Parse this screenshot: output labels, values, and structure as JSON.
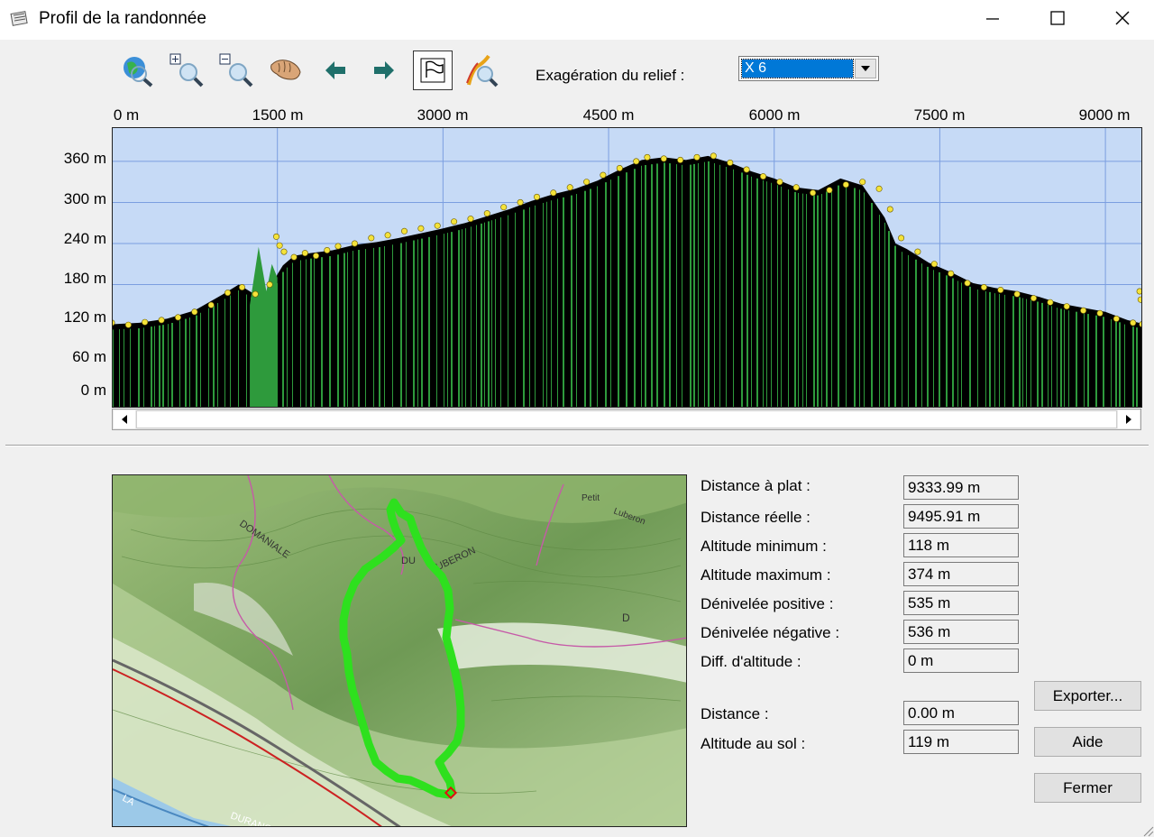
{
  "window": {
    "title": "Profil de la randonnée",
    "icon": "notepad-app-icon",
    "controls": [
      "minimize-icon",
      "maximize-icon",
      "close-icon"
    ]
  },
  "toolbar": {
    "tools": [
      {
        "name": "globe-zoom-icon"
      },
      {
        "name": "zoom-in-icon"
      },
      {
        "name": "zoom-out-icon"
      },
      {
        "name": "pan-hand-icon"
      },
      {
        "name": "arrow-left-icon"
      },
      {
        "name": "arrow-right-icon"
      },
      {
        "name": "flag-icon",
        "pressed": true
      },
      {
        "name": "path-zoom-icon"
      }
    ],
    "relief_label": "Exagération du relief :",
    "relief_value": "X 6"
  },
  "chart_data": {
    "type": "area",
    "x_ticks": [
      "0 m",
      "1500 m",
      "3000 m",
      "4500 m",
      "6000 m",
      "7500 m",
      "9000 m"
    ],
    "y_ticks": [
      "360 m",
      "300 m",
      "240 m",
      "180 m",
      "120 m",
      "60 m",
      "0 m"
    ],
    "xlim": [
      0,
      9333.99
    ],
    "ylim": [
      0,
      410
    ],
    "grid": true,
    "x": [
      0,
      250,
      500,
      750,
      1000,
      1150,
      1300,
      1400,
      1500,
      1550,
      1650,
      1800,
      2000,
      2200,
      2400,
      2600,
      2800,
      3000,
      3200,
      3400,
      3600,
      3800,
      4000,
      4200,
      4400,
      4600,
      4800,
      5000,
      5200,
      5400,
      5600,
      5800,
      6000,
      6200,
      6400,
      6600,
      6800,
      7000,
      7100,
      7200,
      7400,
      7600,
      7800,
      8000,
      8200,
      8400,
      8600,
      8800,
      9000,
      9200,
      9333
    ],
    "y": [
      122,
      124,
      130,
      142,
      165,
      180,
      165,
      158,
      195,
      208,
      222,
      226,
      230,
      238,
      242,
      248,
      255,
      262,
      270,
      280,
      290,
      302,
      312,
      320,
      332,
      348,
      362,
      366,
      362,
      368,
      358,
      345,
      335,
      322,
      318,
      335,
      325,
      278,
      240,
      232,
      212,
      198,
      182,
      175,
      170,
      162,
      152,
      146,
      140,
      128,
      123
    ],
    "series": [
      {
        "values_ref": "y",
        "color": "#000000"
      },
      {
        "markers": [
          [
            0,
            124
          ],
          [
            150,
            121
          ],
          [
            300,
            125
          ],
          [
            450,
            128
          ],
          [
            600,
            132
          ],
          [
            750,
            140
          ],
          [
            900,
            150
          ],
          [
            1050,
            168
          ],
          [
            1180,
            176
          ],
          [
            1300,
            166
          ],
          [
            1430,
            180
          ],
          [
            1490,
            250
          ],
          [
            1520,
            237
          ],
          [
            1560,
            228
          ],
          [
            1650,
            220
          ],
          [
            1750,
            226
          ],
          [
            1850,
            222
          ],
          [
            1950,
            230
          ],
          [
            2050,
            236
          ],
          [
            2200,
            240
          ],
          [
            2350,
            248
          ],
          [
            2500,
            252
          ],
          [
            2650,
            258
          ],
          [
            2800,
            262
          ],
          [
            2950,
            266
          ],
          [
            3100,
            272
          ],
          [
            3250,
            276
          ],
          [
            3400,
            284
          ],
          [
            3550,
            293
          ],
          [
            3700,
            300
          ],
          [
            3850,
            308
          ],
          [
            4000,
            314
          ],
          [
            4150,
            322
          ],
          [
            4300,
            330
          ],
          [
            4450,
            340
          ],
          [
            4600,
            350
          ],
          [
            4750,
            360
          ],
          [
            4850,
            366
          ],
          [
            5000,
            364
          ],
          [
            5150,
            362
          ],
          [
            5300,
            366
          ],
          [
            5450,
            368
          ],
          [
            5600,
            358
          ],
          [
            5750,
            348
          ],
          [
            5900,
            338
          ],
          [
            6050,
            330
          ],
          [
            6200,
            322
          ],
          [
            6350,
            314
          ],
          [
            6500,
            318
          ],
          [
            6650,
            326
          ],
          [
            6800,
            330
          ],
          [
            6950,
            320
          ],
          [
            7050,
            290
          ],
          [
            7150,
            248
          ],
          [
            7300,
            228
          ],
          [
            7450,
            210
          ],
          [
            7600,
            196
          ],
          [
            7750,
            182
          ],
          [
            7900,
            176
          ],
          [
            8050,
            172
          ],
          [
            8200,
            166
          ],
          [
            8350,
            160
          ],
          [
            8500,
            154
          ],
          [
            8650,
            148
          ],
          [
            8800,
            142
          ],
          [
            8950,
            138
          ],
          [
            9100,
            130
          ],
          [
            9250,
            124
          ],
          [
            9333,
            122
          ],
          [
            9310,
            170
          ],
          [
            9320,
            158
          ]
        ],
        "color": "#f5e33a"
      }
    ],
    "green_color": "#2e9a3c",
    "sky_color": "#c6daf6"
  },
  "stats": [
    {
      "label": "Distance à plat :",
      "value": "9333.99 m"
    },
    {
      "label": "Distance réelle :",
      "value": "9495.91 m"
    },
    {
      "label": "Altitude minimum :",
      "value": "118 m"
    },
    {
      "label": "Altitude maximum :",
      "value": "374 m"
    },
    {
      "label": "Dénivelée positive :",
      "value": "535 m"
    },
    {
      "label": "Dénivelée négative :",
      "value": "536 m"
    },
    {
      "label": "Diff. d'altitude :",
      "value": "0 m"
    }
  ],
  "cursor": [
    {
      "label": "Distance :",
      "value": "0.00 m"
    },
    {
      "label": "Altitude au sol :",
      "value": "119 m"
    }
  ],
  "buttons": {
    "export": "Exporter...",
    "help": "Aide",
    "close": "Fermer"
  },
  "map": {
    "labels": [
      "DOMANIALE",
      "DU",
      "LUBERON",
      "Petit",
      "Luberon",
      "D",
      "LA",
      "DURANCE"
    ],
    "route_color": "#2ee01e"
  }
}
